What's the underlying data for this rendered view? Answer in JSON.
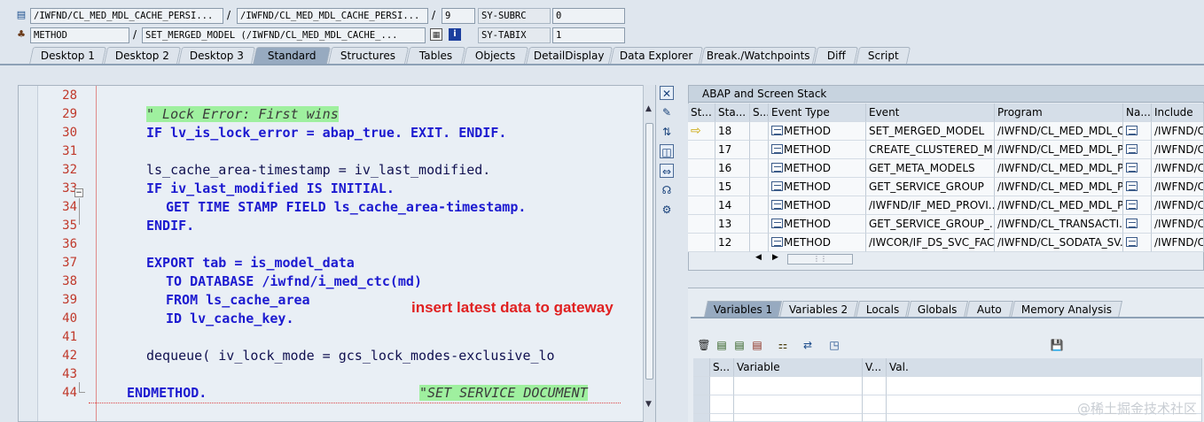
{
  "header": {
    "row1": {
      "include_field": "/IWFND/CL_MED_MDL_CACHE_PERSI...",
      "program_field": "/IWFND/CL_MED_MDL_CACHE_PERSI...",
      "line_field": "9",
      "var_name": "SY-SUBRC",
      "var_value": "0"
    },
    "row2": {
      "event_type": "METHOD",
      "event_name": "SET_MERGED_MODEL (/IWFND/CL_MED_MDL_CACHE_...",
      "var_name": "SY-TABIX",
      "var_value": "1"
    },
    "separator": "/"
  },
  "main_tabs": [
    "Desktop 1",
    "Desktop 2",
    "Desktop 3",
    "Standard",
    "Structures",
    "Tables",
    "Objects",
    "DetailDisplay",
    "Data Explorer",
    "Break./Watchpoints",
    "Diff",
    "Script"
  ],
  "editor": {
    "lines": [
      {
        "no": "28",
        "code": ""
      },
      {
        "no": "29",
        "code": "\" Lock Error: First wins"
      },
      {
        "no": "30",
        "code": "IF lv_is_lock_error = abap_true. EXIT. ENDIF."
      },
      {
        "no": "31",
        "code": ""
      },
      {
        "no": "32",
        "code": "ls_cache_area-timestamp = iv_last_modified."
      },
      {
        "no": "33",
        "code": "IF iv_last_modified IS INITIAL."
      },
      {
        "no": "34",
        "code": "GET TIME STAMP FIELD ls_cache_area-timestamp."
      },
      {
        "no": "35",
        "code": "ENDIF."
      },
      {
        "no": "36",
        "code": ""
      },
      {
        "no": "37",
        "code": "EXPORT tab = is_model_data"
      },
      {
        "no": "38",
        "code": "TO DATABASE /iwfnd/i_med_ctc(md)"
      },
      {
        "no": "39",
        "code": "FROM ls_cache_area"
      },
      {
        "no": "40",
        "code": "ID lv_cache_key."
      },
      {
        "no": "41",
        "code": ""
      },
      {
        "no": "42",
        "code": "dequeue( iv_lock_mode = gcs_lock_modes-exclusive_lo"
      },
      {
        "no": "43",
        "code": ""
      },
      {
        "no": "44",
        "code": "ENDMETHOD."
      }
    ],
    "trailing_comment": "\"SET SERVICE DOCUMENT",
    "annotation": "insert latest data to gateway"
  },
  "stack": {
    "title": "ABAP and Screen Stack",
    "columns": [
      "St...",
      "Sta...",
      "S...",
      "Event Type",
      "Event",
      "Program",
      "Na...",
      "Include"
    ],
    "rows": [
      {
        "level": "18",
        "type": "METHOD",
        "event": "SET_MERGED_MODEL",
        "program": "/IWFND/CL_MED_MDL_C...",
        "include": "/IWFND/CL"
      },
      {
        "level": "17",
        "type": "METHOD",
        "event": "CREATE_CLUSTERED_M...",
        "program": "/IWFND/CL_MED_MDL_P...",
        "include": "/IWFND/CL"
      },
      {
        "level": "16",
        "type": "METHOD",
        "event": "GET_META_MODELS",
        "program": "/IWFND/CL_MED_MDL_P...",
        "include": "/IWFND/CL"
      },
      {
        "level": "15",
        "type": "METHOD",
        "event": "GET_SERVICE_GROUP",
        "program": "/IWFND/CL_MED_MDL_P...",
        "include": "/IWFND/CL"
      },
      {
        "level": "14",
        "type": "METHOD",
        "event": "/IWFND/IF_MED_PROVI...",
        "program": "/IWFND/CL_MED_MDL_P...",
        "include": "/IWFND/CL"
      },
      {
        "level": "13",
        "type": "METHOD",
        "event": "GET_SERVICE_GROUP_...",
        "program": "/IWFND/CL_TRANSACTI...",
        "include": "/IWFND/CL"
      },
      {
        "level": "12",
        "type": "METHOD",
        "event": "/IWCOR/IF_DS_SVC_FAC...",
        "program": "/IWFND/CL_SODATA_SV...",
        "include": "/IWFND/CL"
      }
    ]
  },
  "variables": {
    "tabs": [
      "Variables 1",
      "Variables 2",
      "Locals",
      "Globals",
      "Auto",
      "Memory Analysis"
    ],
    "columns": [
      "S...",
      "Variable",
      "V...",
      "Val."
    ]
  },
  "watermark": "@稀土掘金技术社区"
}
